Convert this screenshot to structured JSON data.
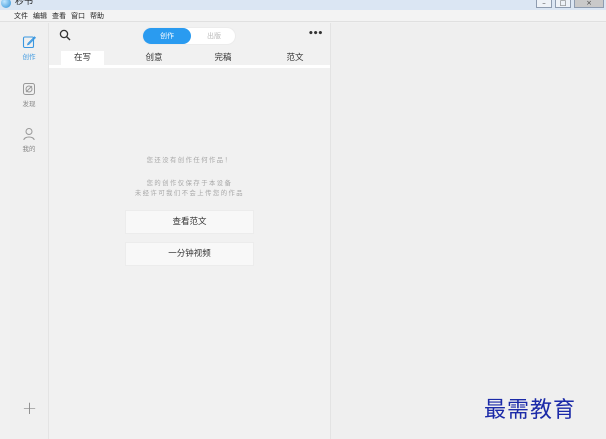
{
  "window": {
    "title": "秒书"
  },
  "menu": [
    "文件",
    "编辑",
    "查看",
    "窗口",
    "帮助"
  ],
  "rail": {
    "items": [
      {
        "label": "创作",
        "icon": "edit-icon",
        "active": true
      },
      {
        "label": "发现",
        "icon": "compass-icon",
        "active": false
      },
      {
        "label": "我的",
        "icon": "user-icon",
        "active": false
      }
    ],
    "add_icon": "plus-icon",
    "add_glyph": "+"
  },
  "toolbar": {
    "segment": {
      "active": "创作",
      "inactive": "出版"
    },
    "more": "•••"
  },
  "tabs": [
    "在写",
    "创意",
    "完稿",
    "范文"
  ],
  "empty": {
    "line1": "您还没有创作任何作品！",
    "line2": "您的创作仅保存于本设备",
    "line3": "未经许可我们不会上传您的作品"
  },
  "buttons": {
    "view_samples": "查看范文",
    "one_min_video": "一分钟视频"
  },
  "watermark": "最需教育",
  "colors": {
    "accent": "#2a9bf0",
    "watermark": "#1b2aa8"
  }
}
